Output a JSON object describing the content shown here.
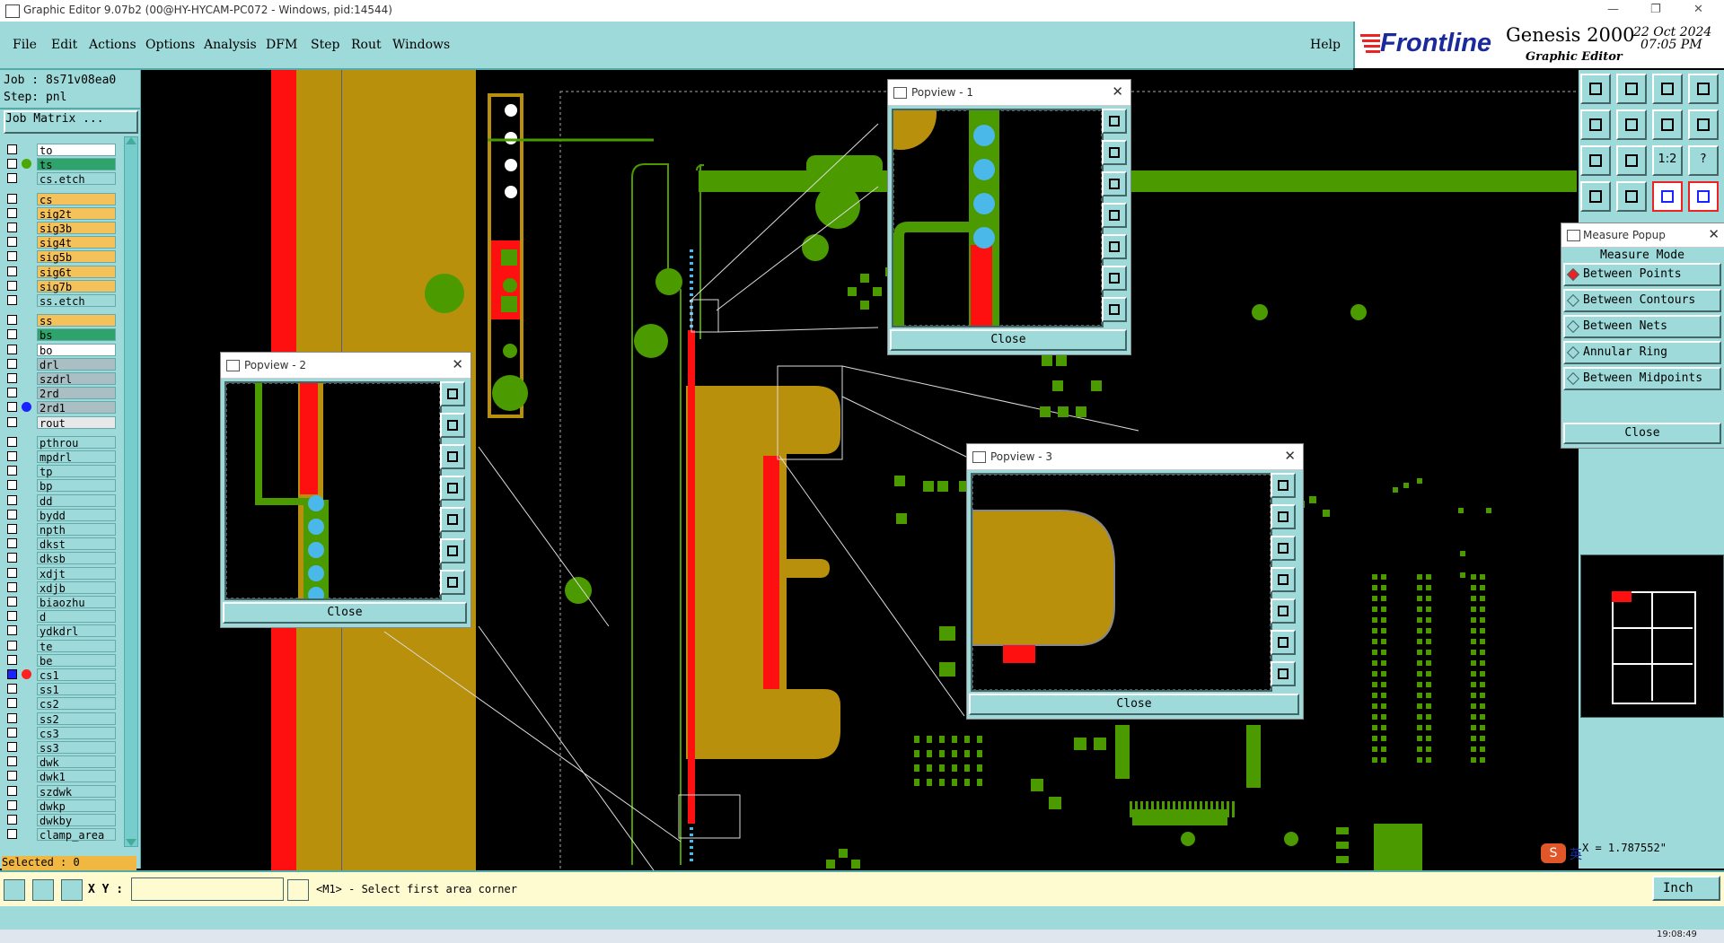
{
  "window": {
    "title": "Graphic Editor 9.07b2 (00@HY-HYCAM-PC072 - Windows, pid:14544)",
    "controls": [
      "—",
      "❐",
      "✕"
    ]
  },
  "menu": {
    "items": [
      "File",
      "Edit",
      "Actions",
      "Options",
      "Analysis",
      "DFM",
      "Step",
      "Rout",
      "Windows"
    ],
    "help": "Help"
  },
  "brand": {
    "logo": "Frontline",
    "product": "Genesis 2000",
    "subtitle": "Graphic Editor",
    "date": "22 Oct 2024",
    "time": "07:05 PM"
  },
  "job": {
    "job_line": "Job : 8s71v08ea0",
    "step_line": "Step: pnl",
    "matrix_button": "Job Matrix ..."
  },
  "layers": [
    {
      "name": "to",
      "bg": "#ffffff"
    },
    {
      "name": "ts",
      "bg": "#2ea36b",
      "dot": "#4aa800"
    },
    {
      "name": "cs.etch",
      "bg": "#9edada"
    },
    {
      "name": "cs",
      "bg": "#f5c15a"
    },
    {
      "name": "sig2t",
      "bg": "#f5c15a"
    },
    {
      "name": "sig3b",
      "bg": "#f5c15a"
    },
    {
      "name": "sig4t",
      "bg": "#f5c15a"
    },
    {
      "name": "sig5b",
      "bg": "#f5c15a"
    },
    {
      "name": "sig6t",
      "bg": "#f5c15a"
    },
    {
      "name": "sig7b",
      "bg": "#f5c15a"
    },
    {
      "name": "ss.etch",
      "bg": "#9edada"
    },
    {
      "name": "ss",
      "bg": "#f5c15a"
    },
    {
      "name": "bs",
      "bg": "#2ea36b"
    },
    {
      "name": "bo",
      "bg": "#ffffff"
    },
    {
      "name": "drl",
      "bg": "#a9bfc4"
    },
    {
      "name": "szdrl",
      "bg": "#a9bfc4"
    },
    {
      "name": "2rd",
      "bg": "#a9bfc4"
    },
    {
      "name": "2rd1",
      "bg": "#a9bfc4",
      "dot": "#1a22ff"
    },
    {
      "name": "rout",
      "bg": "#e8e8e8"
    },
    {
      "name": "pthrou",
      "bg": "#9edada"
    },
    {
      "name": "mpdrl",
      "bg": "#9edada"
    },
    {
      "name": "tp",
      "bg": "#9edada"
    },
    {
      "name": "bp",
      "bg": "#9edada"
    },
    {
      "name": "dd",
      "bg": "#9edada"
    },
    {
      "name": "bydd",
      "bg": "#9edada"
    },
    {
      "name": "npth",
      "bg": "#9edada"
    },
    {
      "name": "dkst",
      "bg": "#9edada"
    },
    {
      "name": "dksb",
      "bg": "#9edada"
    },
    {
      "name": "xdjt",
      "bg": "#9edada"
    },
    {
      "name": "xdjb",
      "bg": "#9edada"
    },
    {
      "name": "biaozhu",
      "bg": "#9edada"
    },
    {
      "name": "d",
      "bg": "#9edada"
    },
    {
      "name": "ydkdrl",
      "bg": "#9edada"
    },
    {
      "name": "te",
      "bg": "#9edada"
    },
    {
      "name": "be",
      "bg": "#9edada"
    },
    {
      "name": "cs1",
      "bg": "#9edada",
      "dot": "#ff2020",
      "active": true
    },
    {
      "name": "ss1",
      "bg": "#9edada"
    },
    {
      "name": "cs2",
      "bg": "#9edada"
    },
    {
      "name": "ss2",
      "bg": "#9edada"
    },
    {
      "name": "cs3",
      "bg": "#9edada"
    },
    {
      "name": "ss3",
      "bg": "#9edada"
    },
    {
      "name": "dwk",
      "bg": "#9edada"
    },
    {
      "name": "dwk1",
      "bg": "#9edada"
    },
    {
      "name": "szdwk",
      "bg": "#9edada"
    },
    {
      "name": "dwkp",
      "bg": "#9edada"
    },
    {
      "name": "dwkby",
      "bg": "#9edada"
    },
    {
      "name": "clamp_area",
      "bg": "#9edada"
    }
  ],
  "selected_label": "Selected : 0",
  "popviews": [
    {
      "title": "Popview - 1",
      "close": "Close"
    },
    {
      "title": "Popview - 2",
      "close": "Close"
    },
    {
      "title": "Popview - 3",
      "close": "Close"
    }
  ],
  "measure": {
    "title": "Measure Popup",
    "mode_label": "Measure Mode",
    "options": [
      "Between Points",
      "Between Contours",
      "Between Nets",
      "Annular Ring",
      "Between Midpoints"
    ],
    "close": "Close"
  },
  "toolbar_labels": {
    "scale": "1:2",
    "help": "?"
  },
  "coord_readout": "X = 1.787552\"",
  "status": {
    "xy_label": "X Y :",
    "xy_value": "",
    "prompt": "<M1> - Select first area corner",
    "units": "Inch"
  },
  "taskbar_time": "19:08:49",
  "ime": {
    "lang": "英"
  },
  "colors": {
    "panel": "#9edada",
    "copper": "#b8900c",
    "green": "#4a9a00",
    "red": "#ff1010",
    "cyan_pad": "#4ab8e8"
  }
}
